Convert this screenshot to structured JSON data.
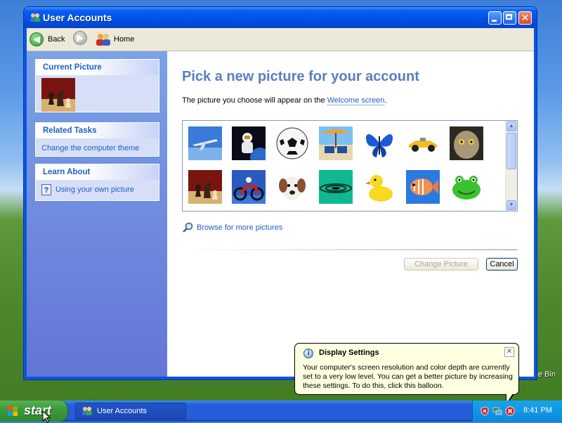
{
  "desktop": {
    "recycle_bin_label": "e Bin"
  },
  "window": {
    "title": "User Accounts",
    "toolbar": {
      "back_label": "Back",
      "home_label": "Home"
    }
  },
  "sidebar": {
    "current_picture": {
      "header": "Current Picture"
    },
    "related_tasks": {
      "header": "Related Tasks",
      "items": [
        "Change the computer theme"
      ]
    },
    "learn_about": {
      "header": "Learn About",
      "items": [
        "Using your own picture"
      ]
    }
  },
  "main": {
    "heading": "Pick a new picture for your account",
    "description_prefix": "The picture you choose will appear on the ",
    "description_link": "Welcome screen",
    "description_suffix": ".",
    "pictures": [
      "airplane",
      "astronaut",
      "soccer-ball",
      "beach-chairs",
      "butterfly",
      "car",
      "cat",
      "chess",
      "dirt-bike",
      "dog",
      "drip",
      "duck",
      "fish",
      "frog"
    ],
    "browse_label": "Browse for more pictures",
    "change_picture_label": "Change Picture",
    "cancel_label": "Cancel"
  },
  "balloon": {
    "title": "Display Settings",
    "text": "Your computer's screen resolution and color depth are currently set to a very low level. You can get a better picture by increasing these settings. To do this, click this balloon."
  },
  "taskbar": {
    "start_label": "start",
    "task_label": "User Accounts",
    "clock": "8:41 PM"
  },
  "colors": {
    "title_blue": "#0050e8",
    "sidebar_gradient_top": "#7ba2e7",
    "heading_blue": "#5a7fbf",
    "link_blue": "#215dc6",
    "taskbar_blue": "#245edb",
    "start_green": "#3c9a3c",
    "balloon_yellow": "#ffffe1"
  }
}
